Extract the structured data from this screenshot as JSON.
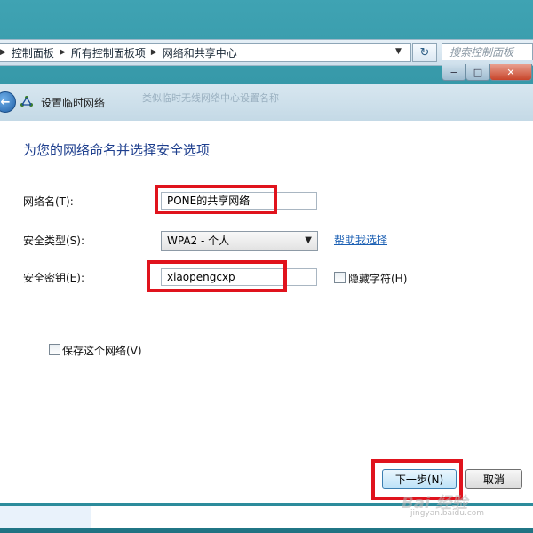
{
  "explorer": {
    "breadcrumb": [
      "控制面板",
      "所有控制面板项",
      "网络和共享中心"
    ],
    "search_placeholder": "搜索控制面板"
  },
  "window_controls": {
    "min": "−",
    "max": "□",
    "close": "✕"
  },
  "dialog": {
    "title": "设置临时网络",
    "ghost_text": "类似临时无线网络中心设置名称",
    "heading": "为您的网络命名并选择安全选项"
  },
  "form": {
    "network_name_label": "网络名(T):",
    "network_name_value": "PONE的共享网络",
    "security_type_label": "安全类型(S):",
    "security_type_value": "WPA2 - 个人",
    "help_link": "帮助我选择",
    "security_key_label": "安全密钥(E):",
    "security_key_value": "xiaopengcxp",
    "hide_chars_label": "隐藏字符(H)",
    "save_network_label": "保存这个网络(V)"
  },
  "buttons": {
    "next": "下一步(N)",
    "cancel": "取消"
  },
  "watermark": {
    "logo": "Bai 经验",
    "url": "jingyan.baidu.com"
  },
  "colors": {
    "highlight": "#e0131d",
    "heading": "#1e3f8e",
    "link": "#1b5fb3"
  }
}
